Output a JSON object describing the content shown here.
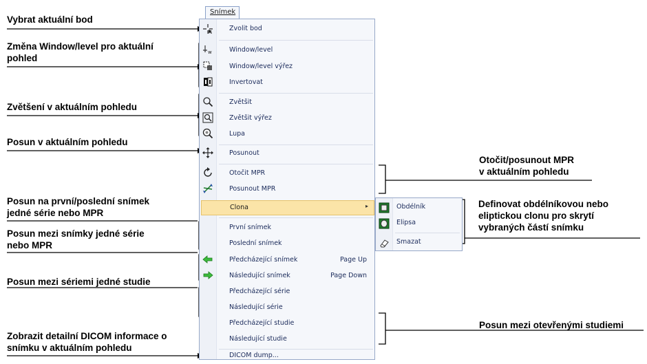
{
  "menu": {
    "tab_label": "Snímek",
    "items": [
      {
        "label": "Zvolit bod",
        "icon": "crosshair-pointer-icon"
      },
      {
        "label": "Window/level",
        "icon": "window-level-icon"
      },
      {
        "label": "Window/level výřez",
        "icon": "window-level-region-icon"
      },
      {
        "label": "Invertovat",
        "icon": "invert-icon"
      },
      {
        "label": "Zvětšit",
        "icon": "zoom-icon"
      },
      {
        "label": "Zvětšit výřez",
        "icon": "zoom-region-icon"
      },
      {
        "label": "Lupa",
        "icon": "magnifier-icon"
      },
      {
        "label": "Posunout",
        "icon": "pan-icon"
      },
      {
        "label": "Otočit MPR",
        "icon": "rotate-icon"
      },
      {
        "label": "Posunout MPR",
        "icon": "move-mpr-icon"
      },
      {
        "label": "Clona",
        "icon": "",
        "submenu_arrow": "▸"
      },
      {
        "label": "První snímek",
        "icon": ""
      },
      {
        "label": "Poslední snímek",
        "icon": ""
      },
      {
        "label": "Předcházející snímek",
        "icon": "arrow-left-icon",
        "shortcut": "Page Up"
      },
      {
        "label": "Následující snímek",
        "icon": "arrow-right-icon",
        "shortcut": "Page Down"
      },
      {
        "label": "Předcházející série",
        "icon": ""
      },
      {
        "label": "Následující série",
        "icon": ""
      },
      {
        "label": "Předcházející studie",
        "icon": ""
      },
      {
        "label": "Následující studie",
        "icon": ""
      },
      {
        "label": "DICOM dump...",
        "icon": ""
      }
    ],
    "submenu": [
      {
        "label": "Obdélník",
        "icon": "rectangle-shutter-icon"
      },
      {
        "label": "Elipsa",
        "icon": "ellipse-shutter-icon"
      },
      {
        "label": "Smazat",
        "icon": "eraser-icon"
      }
    ]
  },
  "annotations": {
    "select_point": [
      "Vybrat aktuální bod"
    ],
    "window_level": [
      "Změna Window/level pro aktuální",
      "pohled"
    ],
    "zoom": [
      "Zvětšení v aktuálním pohledu"
    ],
    "pan": [
      "Posun v aktuálním pohledu"
    ],
    "mpr": [
      "Otočit/posunout MPR",
      "v aktuálním pohledu"
    ],
    "first_last": [
      "Posun na první/poslední snímek",
      "jedné série nebo MPR"
    ],
    "between_images": [
      "Posun mezi snímky jedné série",
      "nebo MPR"
    ],
    "shutter": [
      "Definovat obdélníkovou nebo",
      "eliptickou clonu pro skrytí",
      "vybraných částí snímku"
    ],
    "between_series": [
      "Posun mezi sériemi jedné studie"
    ],
    "between_studies": [
      "Posun mezi otevřenými studiemi"
    ],
    "dicom": [
      "Zobrazit detailní DICOM informace o",
      "snímku v aktuálním pohledu"
    ]
  },
  "colors": {
    "menu_bg": "#f5f7fb",
    "highlight": "#fbe4a8",
    "menu_text": "#1a2a5a",
    "arrow_green": "#2aa52a"
  }
}
